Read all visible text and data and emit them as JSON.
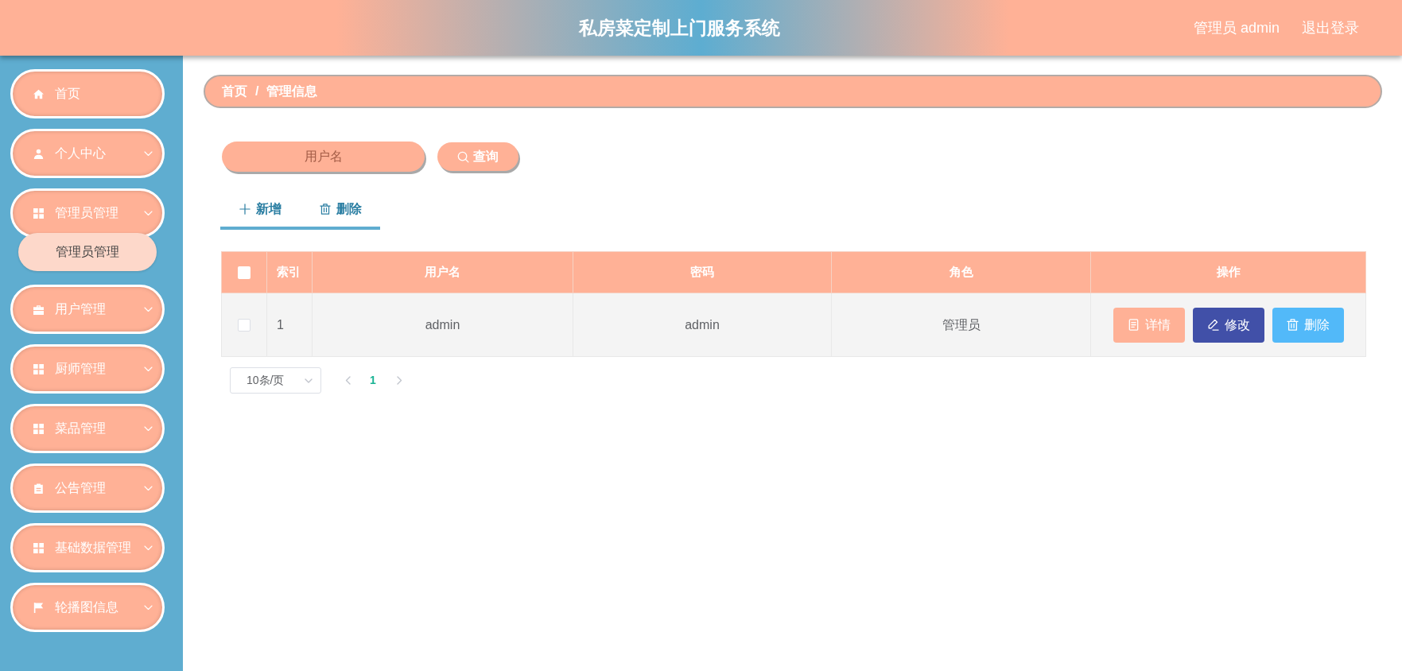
{
  "header": {
    "title": "私房菜定制上门服务系统",
    "user": "管理员 admin",
    "logout": "退出登录"
  },
  "sidebar": {
    "items": [
      {
        "label": "首页",
        "kind": "link"
      },
      {
        "label": "个人中心",
        "kind": "menu"
      },
      {
        "label": "管理员管理",
        "kind": "menu",
        "children": [
          {
            "label": "管理员管理"
          }
        ]
      },
      {
        "label": "用户管理",
        "kind": "menu"
      },
      {
        "label": "厨师管理",
        "kind": "menu"
      },
      {
        "label": "菜品管理",
        "kind": "menu"
      },
      {
        "label": "公告管理",
        "kind": "menu"
      },
      {
        "label": "基础数据管理",
        "kind": "menu"
      },
      {
        "label": "轮播图信息",
        "kind": "menu"
      }
    ]
  },
  "breadcrumb": {
    "items": [
      "首页",
      "管理信息"
    ],
    "separator": "/"
  },
  "search": {
    "placeholder": "用户名",
    "button": "查询"
  },
  "toolbar": {
    "buttons": [
      {
        "label": "新增",
        "kind": "add"
      },
      {
        "label": "删除",
        "kind": "delete"
      }
    ]
  },
  "table": {
    "select_all": {
      "checked": false
    },
    "columns": [
      "索引",
      "用户名",
      "密码",
      "角色",
      "操作"
    ],
    "rows": [
      {
        "checked": false,
        "cells": [
          "1",
          "admin",
          "admin",
          "管理员"
        ],
        "actions": [
          {
            "label": "详情",
            "kind": "detail"
          },
          {
            "label": "修改",
            "kind": "edit"
          },
          {
            "label": "删除",
            "kind": "delete"
          }
        ]
      }
    ]
  },
  "pagination": {
    "page_size": "10条/页",
    "pages": [
      {
        "label": "1",
        "selected": true
      }
    ]
  }
}
